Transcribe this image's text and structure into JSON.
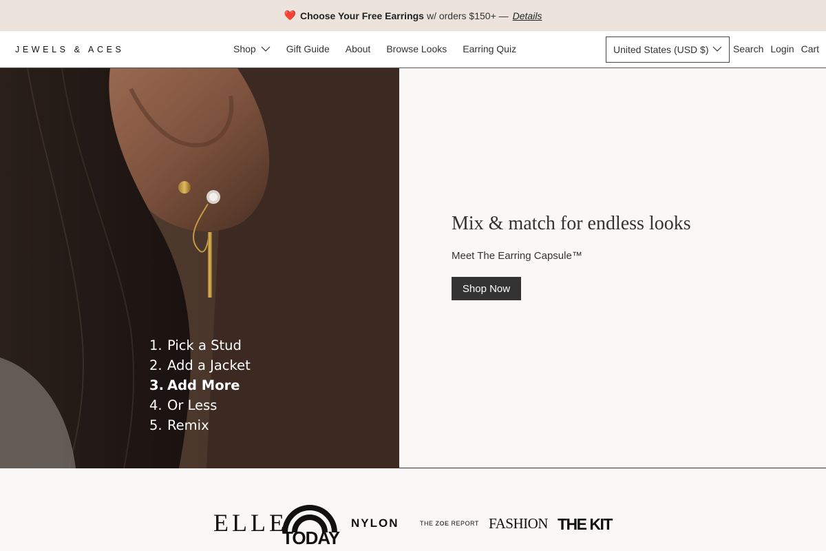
{
  "announcement": {
    "heart": "❤️",
    "bold_text": "Choose Your Free Earrings",
    "text": "w/ orders $150+ —",
    "link": "Details"
  },
  "header": {
    "logo": "JEWELS & ACES",
    "nav": [
      {
        "label": "Shop"
      },
      {
        "label": "Gift Guide"
      },
      {
        "label": "About"
      },
      {
        "label": "Browse Looks"
      },
      {
        "label": "Earring Quiz"
      }
    ],
    "country_selector": "United States (USD $)",
    "links": {
      "search": "Search",
      "login": "Login",
      "cart": "Cart"
    }
  },
  "hero": {
    "steps": [
      {
        "num": "1.",
        "label": "Pick a Stud"
      },
      {
        "num": "2.",
        "label": "Add a Jacket"
      },
      {
        "num": "3.",
        "label": "Add More"
      },
      {
        "num": "4.",
        "label": "Or Less"
      },
      {
        "num": "5.",
        "label": "Remix"
      }
    ],
    "title": "Mix & match for endless looks",
    "subtitle": "Meet The Earring Capsule™",
    "button": "Shop Now"
  },
  "press": {
    "elle": "ELLE",
    "today": "TODAY",
    "nylon": "NYLON",
    "zoe_pre": "THE",
    "zoe_mid": "ZOE",
    "zoe_post": "REPORT",
    "fashion": "FASHION",
    "thekit": "THE KIT"
  },
  "colors": {
    "announcement_bg": "#ece4dc",
    "button_bg": "#333333",
    "heart": "#d32f2f"
  }
}
